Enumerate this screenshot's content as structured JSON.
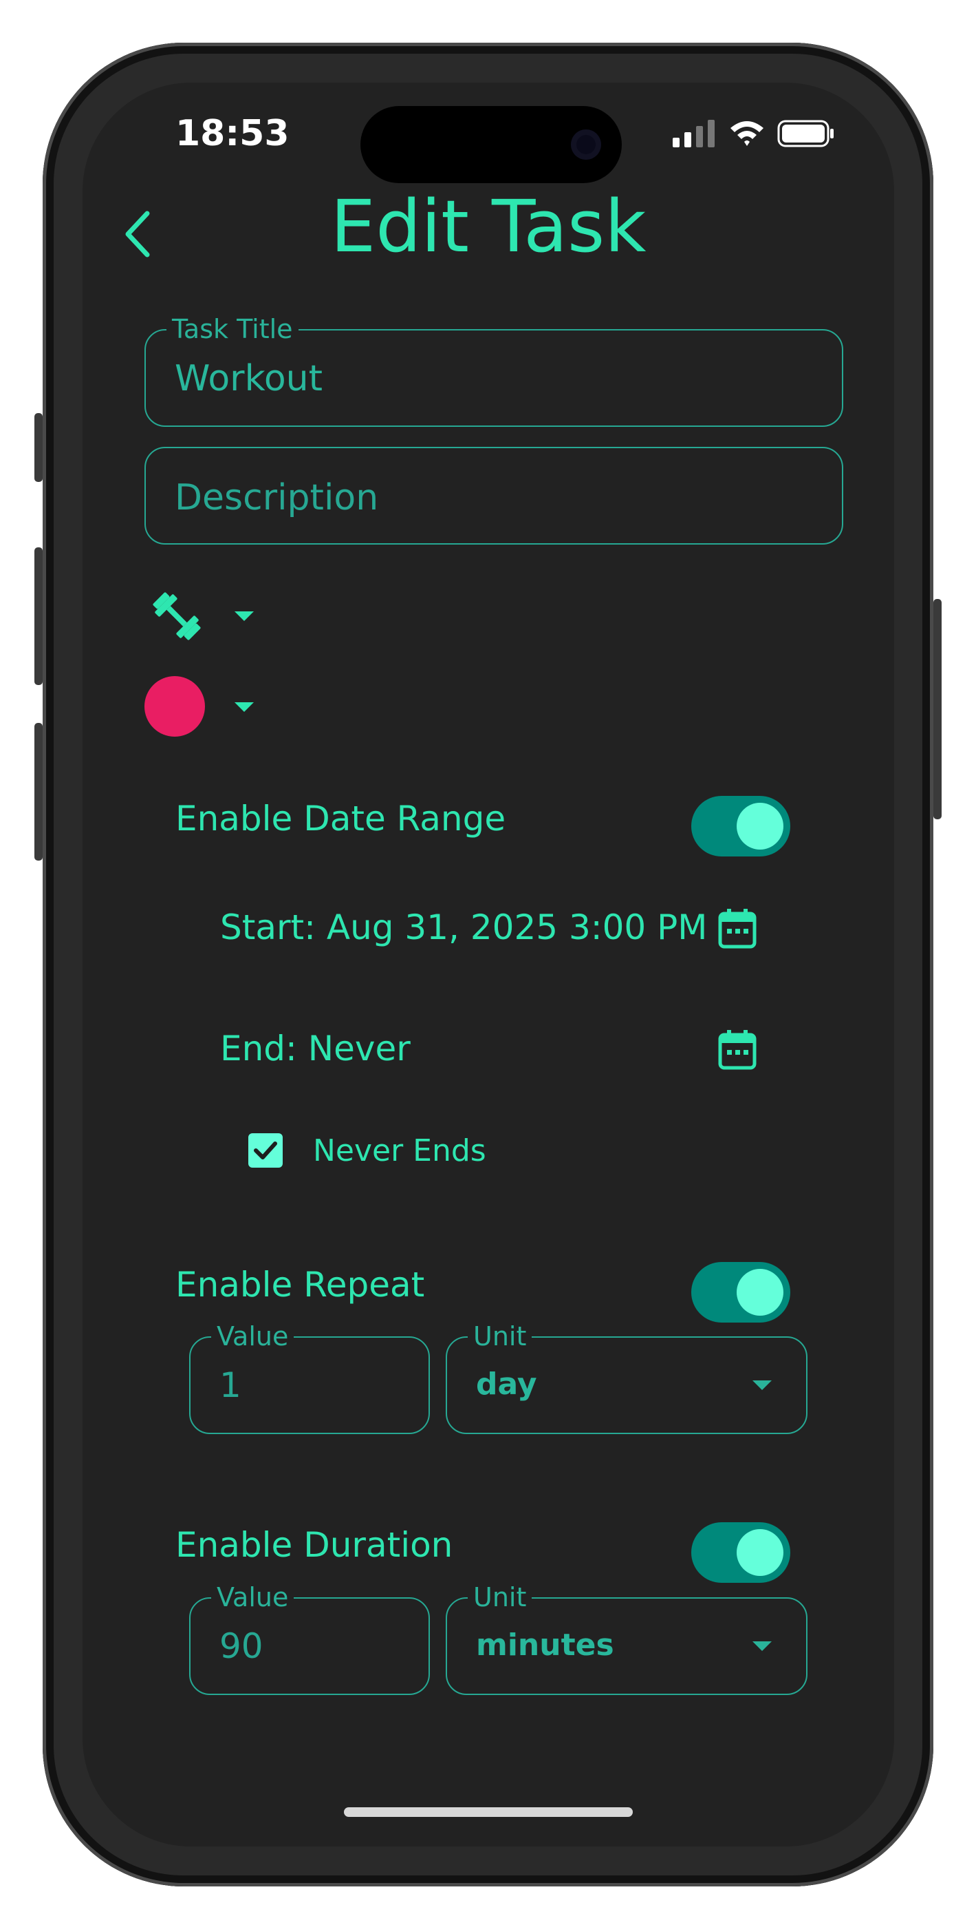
{
  "status_bar": {
    "time": "18:53"
  },
  "header": {
    "title": "Edit Task",
    "back_icon": "chevron-left-icon"
  },
  "task_title": {
    "label": "Task Title",
    "value": "Workout"
  },
  "description": {
    "placeholder": "Description"
  },
  "icon_picker": {
    "icon": "dumbbell-icon"
  },
  "color_picker": {
    "color": "#e91e63"
  },
  "date_range": {
    "label": "Enable Date Range",
    "enabled": true,
    "start_label": "Start: Aug 31, 2025 3:00 PM",
    "end_label": "End: Never",
    "never_ends_label": "Never Ends",
    "never_ends_checked": true
  },
  "repeat": {
    "label": "Enable Repeat",
    "enabled": true,
    "value_label": "Value",
    "value": "1",
    "unit_label": "Unit",
    "unit": "day"
  },
  "duration": {
    "label": "Enable Duration",
    "enabled": true,
    "value_label": "Value",
    "value": "90",
    "unit_label": "Unit",
    "unit": "minutes"
  },
  "colors": {
    "accent": "#2ee6b0",
    "toggle_track": "#00897b",
    "toggle_knob": "#64ffda",
    "background": "#222222"
  }
}
